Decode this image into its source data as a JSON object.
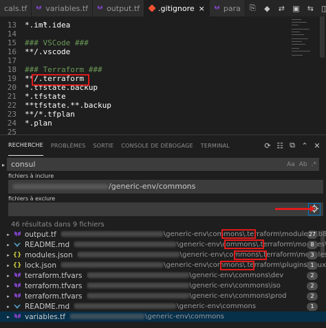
{
  "tabs": [
    {
      "label": "cals.tf",
      "icon": "none",
      "active": false
    },
    {
      "label": "variables.tf",
      "icon": "terraform-icon",
      "active": false
    },
    {
      "label": "output.tf",
      "icon": "terraform-icon",
      "active": false
    },
    {
      "label": ".gitignore",
      "icon": "git-icon",
      "active": true
    },
    {
      "label": "para",
      "icon": "terraform-icon",
      "active": false
    }
  ],
  "tab_close": "×",
  "tab_actions": [
    "⎘",
    "◆",
    "⇄",
    "▣",
    "⇆",
    "◫"
  ],
  "editor": {
    "lines": [
      {
        "n": "13",
        "text": "*.iml",
        "kind": "txt"
      },
      {
        "n": "14",
        "text": "",
        "kind": "txt"
      },
      {
        "n": "15",
        "text": "### VSCode ###",
        "kind": "cmt"
      },
      {
        "n": "16",
        "text": "**/.vscode",
        "kind": "txt"
      },
      {
        "n": "17",
        "text": "",
        "kind": "txt"
      },
      {
        "n": "18",
        "text": "### Terraform ###",
        "kind": "cmt"
      },
      {
        "n": "19",
        "text": "**/.terraform",
        "kind": "txt"
      },
      {
        "n": "20",
        "text": "*.tfstate.backup",
        "kind": "txt"
      },
      {
        "n": "21",
        "text": "*.tfstate",
        "kind": "txt"
      },
      {
        "n": "22",
        "text": "**tfstate.**.backup",
        "kind": "txt"
      },
      {
        "n": "23",
        "text": "**/*.tfplan",
        "kind": "txt"
      },
      {
        "n": "24",
        "text": "*.plan",
        "kind": "txt"
      },
      {
        "n": "25",
        "text": "",
        "kind": "txt"
      }
    ],
    "partial_top": "*.idea"
  },
  "panel": {
    "tabs": [
      "RECHERCHE",
      "PROBLÈMES",
      "SORTIE",
      "CONSOLE DE DÉBOGAGE",
      "TERMINAL"
    ],
    "actions": [
      "⟳",
      "☷",
      "⧉",
      "⌃",
      "✕"
    ],
    "search_value": "consul",
    "search_opts": [
      "Aa",
      "Ab",
      ".*"
    ],
    "include_label": "fichiers à inclure",
    "include_value": "/generic-env/commons",
    "exclude_label": "fichiers à exclure",
    "exclude_value": "",
    "summary": "46 résultats dans 9 fichiers",
    "results": [
      {
        "name": "output.tf",
        "icon": "terraform-icon",
        "chev": "▸",
        "path": "\\generic-env\\commons\\.terraform\\modules\\4b8ea5ac...",
        "count": "27",
        "selected": false
      },
      {
        "name": "README.md",
        "icon": "markdown-icon",
        "chev": "▸",
        "path": "\\generic-env\\commons\\.terraform\\modules\\4b8ea5a...",
        "count": "8",
        "selected": false
      },
      {
        "name": "modules.json",
        "icon": "json-icon",
        "chev": "▸",
        "path": "\\generic-env\\commons\\.terraform\\modules",
        "count": "3",
        "selected": false
      },
      {
        "name": "lock.json",
        "icon": "json-icon",
        "chev": "▸",
        "path": "\\generic-env\\commons\\.terraform\\plugins\\linux_amd64",
        "count": "1",
        "selected": false
      },
      {
        "name": "terraform.tfvars",
        "icon": "terraform-icon",
        "chev": "▸",
        "path": "\\generic-env\\commons\\dev",
        "count": "2",
        "selected": false
      },
      {
        "name": "terraform.tfvars",
        "icon": "terraform-icon",
        "chev": "▸",
        "path": "\\generic-env\\commons\\iso",
        "count": "2",
        "selected": false
      },
      {
        "name": "terraform.tfvars",
        "icon": "terraform-icon",
        "chev": "▸",
        "path": "\\generic-env\\commons\\prod",
        "count": "2",
        "selected": false
      },
      {
        "name": "README.md",
        "icon": "markdown-icon",
        "chev": "▸",
        "path": "\\generic-env\\commons",
        "count": "1",
        "selected": false
      },
      {
        "name": "variables.tf",
        "icon": "terraform-icon",
        "chev": "▸",
        "path": "\\generic-env\\commons",
        "count": "",
        "selected": true
      }
    ]
  },
  "colors": {
    "accent": "#007acc",
    "annotation": "#e01b1b",
    "terraform": "#7b42bc",
    "markdown": "#519aba",
    "json": "#cbcb41"
  }
}
